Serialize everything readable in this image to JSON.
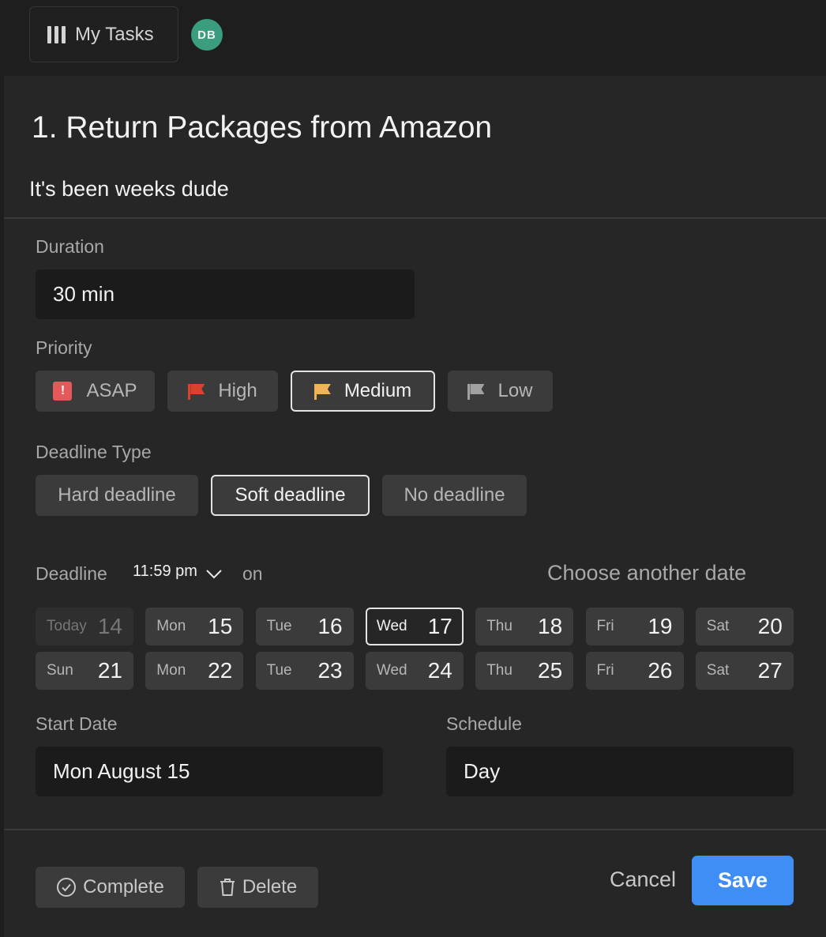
{
  "header": {
    "my_tasks_label": "My Tasks",
    "avatar_initials": "DB"
  },
  "task": {
    "title": "1.  Return Packages from Amazon",
    "description": "It's been weeks dude"
  },
  "duration": {
    "label": "Duration",
    "value": "30 min"
  },
  "priority": {
    "label": "Priority",
    "options": [
      {
        "label": "ASAP",
        "color": "#e5585c",
        "icon": "exclamation-icon"
      },
      {
        "label": "High",
        "color": "#d9432e",
        "icon": "flag-icon"
      },
      {
        "label": "Medium",
        "color": "#f2b25a",
        "icon": "flag-icon",
        "selected": true
      },
      {
        "label": "Low",
        "color": "#a0a0a0",
        "icon": "flag-icon"
      }
    ]
  },
  "deadline_type": {
    "label": "Deadline Type",
    "options": [
      {
        "label": "Hard deadline"
      },
      {
        "label": "Soft deadline",
        "selected": true
      },
      {
        "label": "No deadline"
      }
    ]
  },
  "deadline": {
    "label": "Deadline",
    "time": "11:59 pm",
    "on_label": "on",
    "choose_other": "Choose another date",
    "days": [
      {
        "name": "Today",
        "date": "14",
        "state": "today"
      },
      {
        "name": "Mon",
        "date": "15"
      },
      {
        "name": "Tue",
        "date": "16"
      },
      {
        "name": "Wed",
        "date": "17",
        "state": "selected"
      },
      {
        "name": "Thu",
        "date": "18"
      },
      {
        "name": "Fri",
        "date": "19"
      },
      {
        "name": "Sat",
        "date": "20"
      },
      {
        "name": "Sun",
        "date": "21"
      },
      {
        "name": "Mon",
        "date": "22"
      },
      {
        "name": "Tue",
        "date": "23"
      },
      {
        "name": "Wed",
        "date": "24"
      },
      {
        "name": "Thu",
        "date": "25"
      },
      {
        "name": "Fri",
        "date": "26"
      },
      {
        "name": "Sat",
        "date": "27"
      }
    ]
  },
  "start_date": {
    "label": "Start Date",
    "value": "Mon August 15"
  },
  "schedule": {
    "label": "Schedule",
    "value": "Day"
  },
  "footer": {
    "complete_label": "Complete",
    "delete_label": "Delete",
    "cancel_label": "Cancel",
    "save_label": "Save"
  },
  "colors": {
    "accent": "#3f8ef5",
    "avatar": "#3a9d7f"
  }
}
